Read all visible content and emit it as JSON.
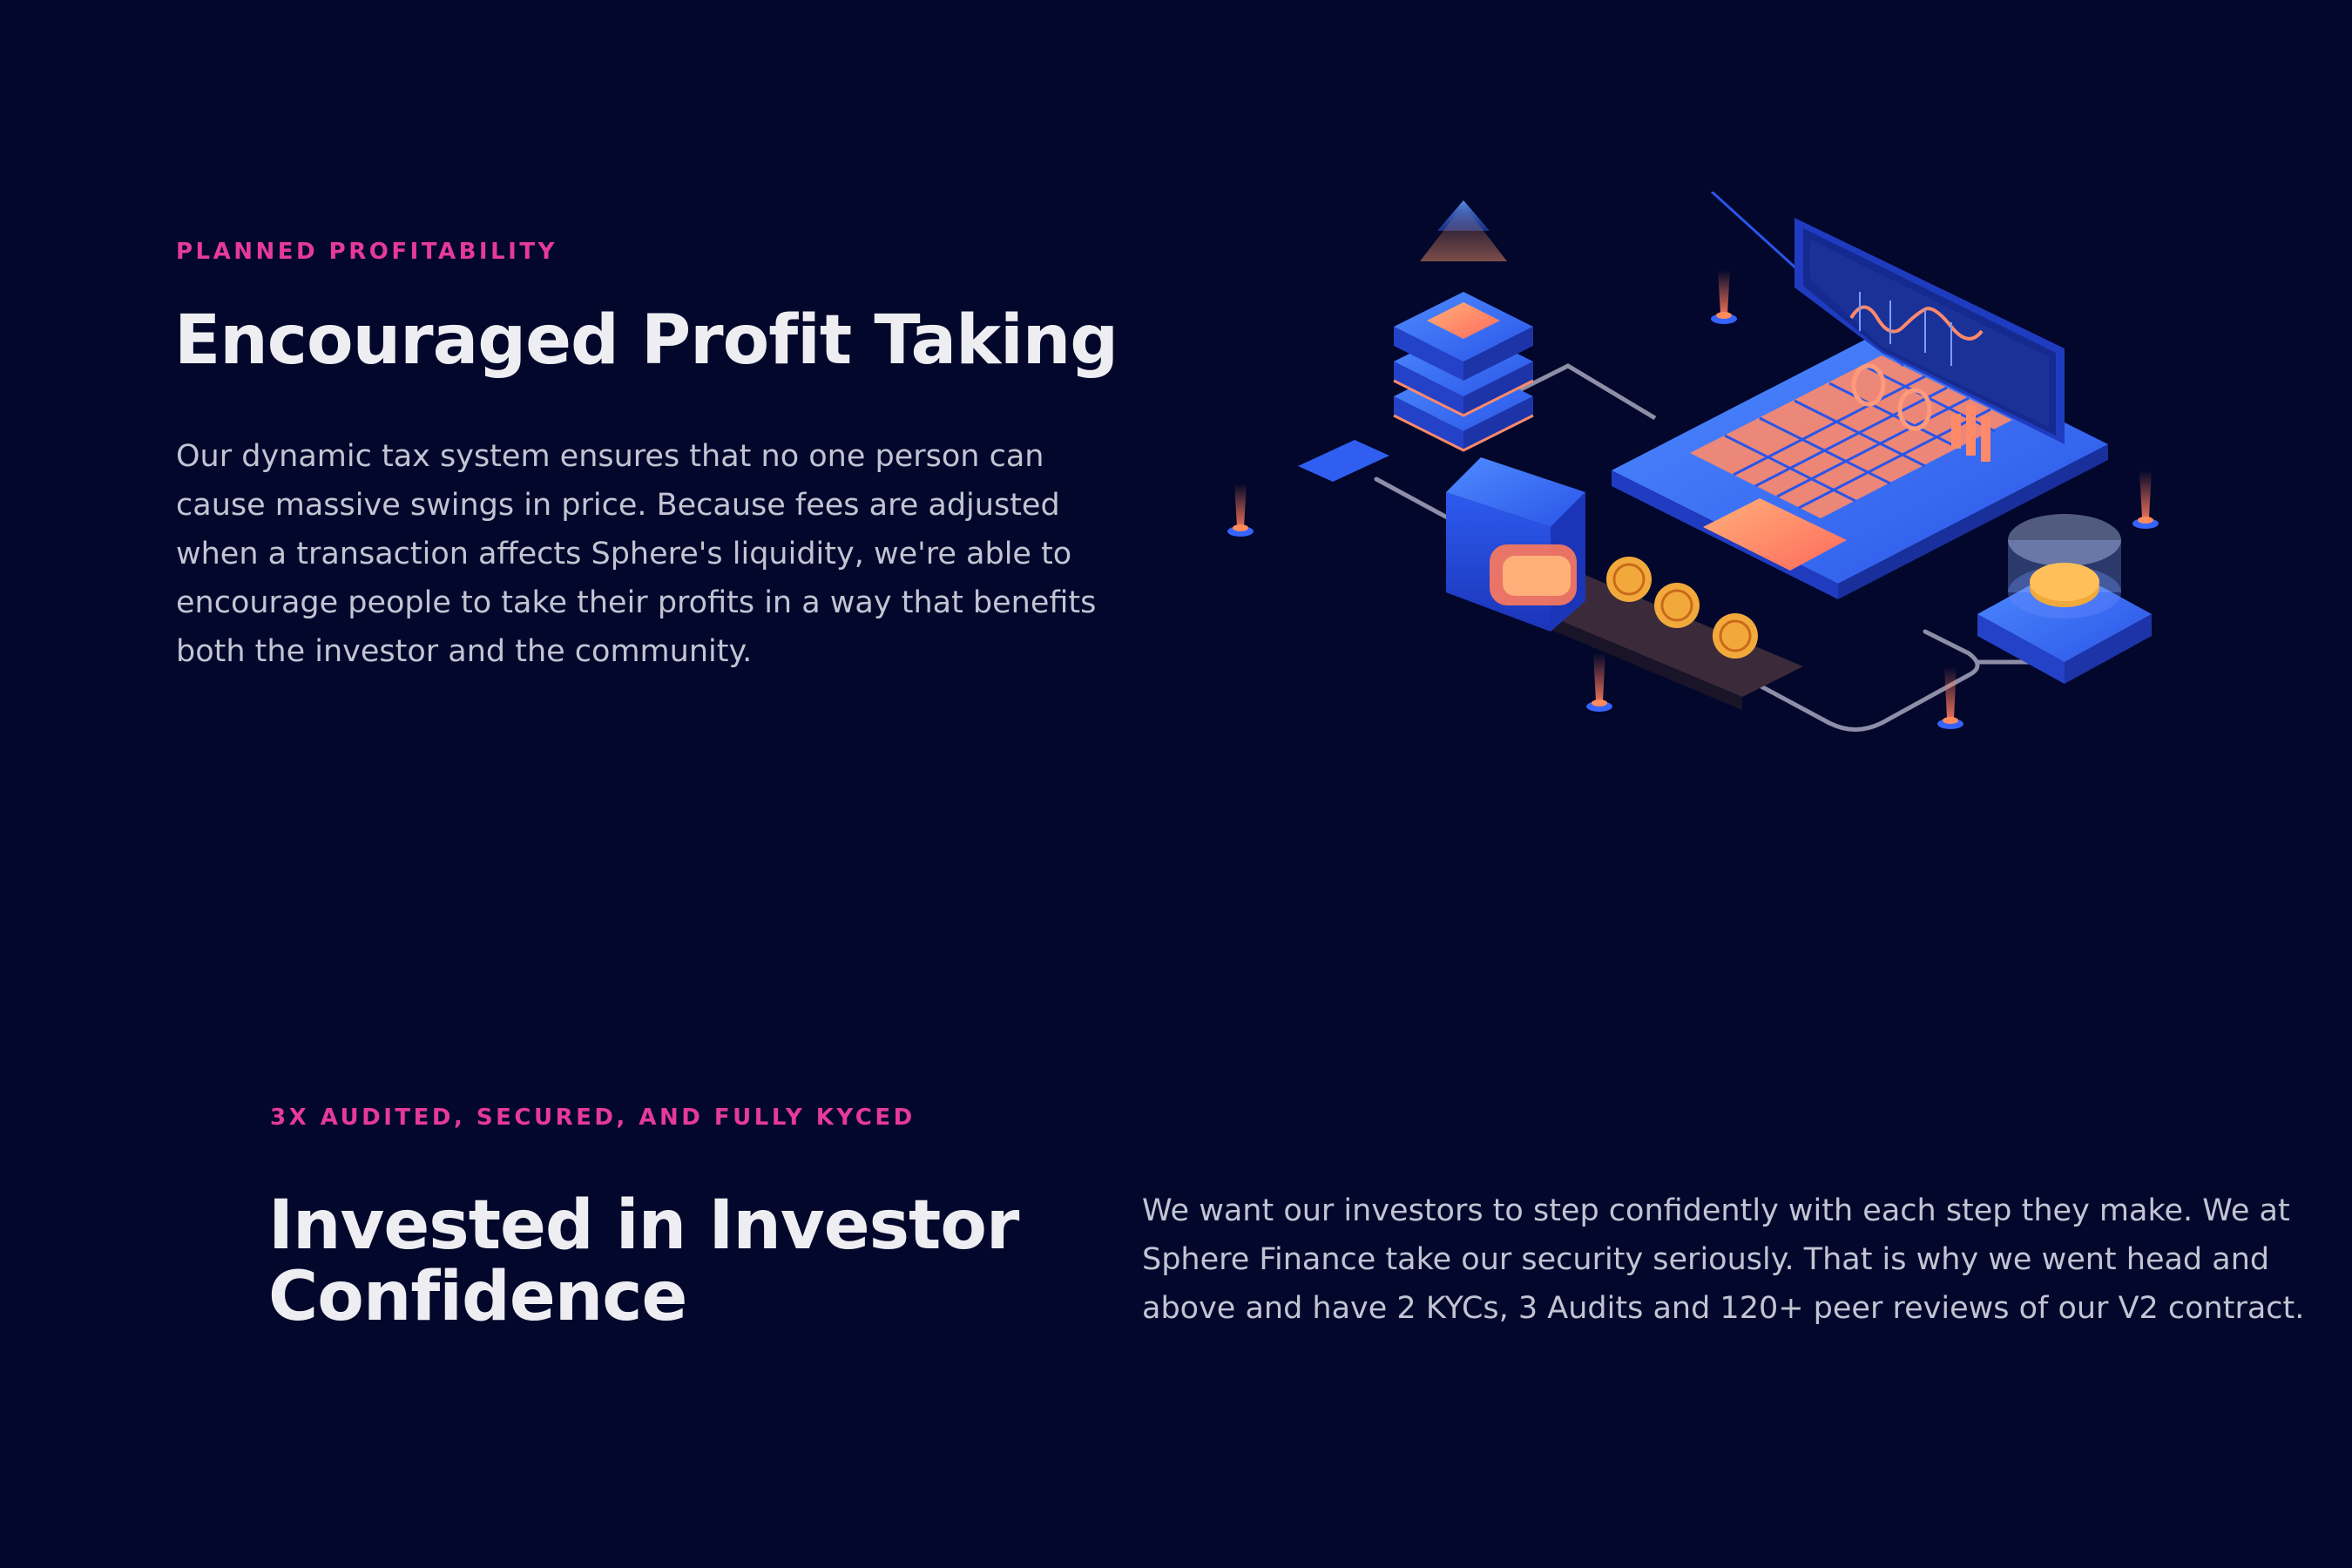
{
  "section_profit": {
    "eyebrow": "PLANNED PROFITABILITY",
    "title": "Encouraged Profit Taking",
    "body": "Our dynamic tax system ensures that no one person can cause massive swings in price. Because fees are adjusted when a transaction affects Sphere's liquidity, we're able to encourage people to take their profits in a way that benefits both the investor and the community."
  },
  "section_confidence": {
    "eyebrow": "3X AUDITED, SECURED, AND FULLY KYCED",
    "title": "Invested in Investor Confidence",
    "body": "We want our investors to step confidently with each step they make. We at Sphere Finance take our security seriously. That is why we went head and above and have 2 KYCs, 3 Audits and 120+ peer reviews of our V2 contract."
  },
  "illustration": {
    "icon": "isometric-crypto-laptop-illustration",
    "colors": {
      "background": "#02072b",
      "accent_pink": "#e5399d",
      "blue": "#2f6bff",
      "orange": "#ff8a5c",
      "coin": "#f2a93b"
    }
  }
}
